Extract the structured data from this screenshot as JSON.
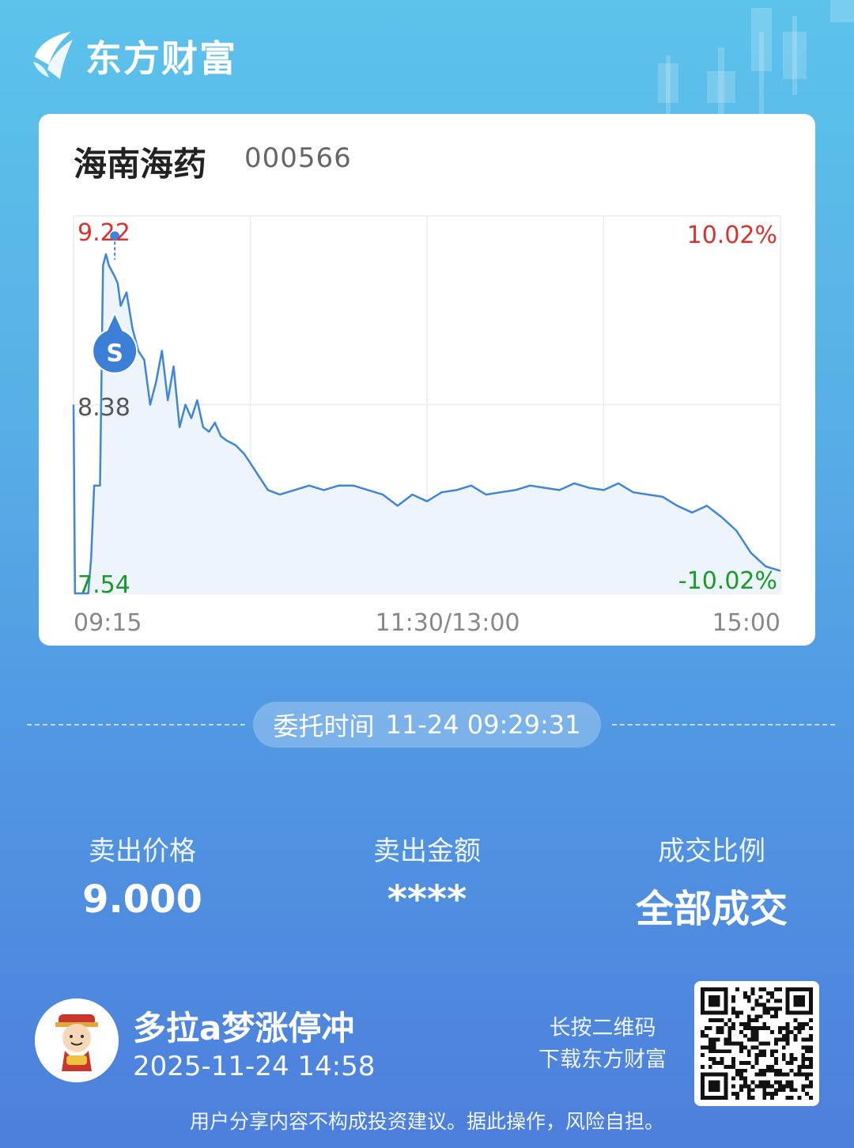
{
  "app": {
    "brand": "东方财富"
  },
  "stock": {
    "name": "海南海药",
    "code": "000566"
  },
  "chart_data": {
    "type": "line",
    "xlabels": [
      "09:15",
      "11:30/13:00",
      "15:00"
    ],
    "ylim": [
      7.54,
      9.22
    ],
    "y_tick_labels": [
      "9.22",
      "8.38",
      "7.54"
    ],
    "pct_labels": {
      "top": "10.02%",
      "bottom": "-10.02%"
    },
    "prev_close": 8.38,
    "marker": {
      "label": "S",
      "time": "09:29",
      "price": 9.0
    },
    "series": [
      {
        "x": [
          0,
          0.5,
          1,
          1.5,
          2,
          3,
          4,
          5,
          6,
          7,
          7.5,
          8,
          9,
          10,
          11,
          12,
          14,
          15,
          16,
          18,
          20,
          22,
          24,
          26,
          28,
          30,
          32,
          34,
          36,
          38,
          40,
          42,
          44,
          46,
          48,
          50,
          52,
          55,
          58,
          62,
          66,
          70,
          75,
          80,
          85,
          90,
          95,
          100,
          105,
          110,
          115,
          120,
          125,
          130,
          135,
          140,
          145,
          150,
          155,
          160,
          165,
          170,
          175,
          180,
          185,
          190,
          195,
          200,
          205,
          210,
          215,
          220,
          225,
          230,
          235,
          240
        ],
        "values": [
          8.38,
          7.54,
          7.54,
          7.54,
          7.54,
          7.54,
          7.54,
          7.54,
          7.7,
          8.02,
          8.02,
          8.02,
          8.02,
          9.0,
          9.05,
          9.0,
          8.95,
          8.92,
          8.82,
          8.88,
          8.72,
          8.62,
          8.58,
          8.38,
          8.48,
          8.62,
          8.4,
          8.55,
          8.28,
          8.38,
          8.32,
          8.4,
          8.28,
          8.26,
          8.3,
          8.24,
          8.22,
          8.2,
          8.16,
          8.08,
          8.0,
          7.98,
          8.0,
          8.02,
          8.0,
          8.02,
          8.02,
          8.0,
          7.98,
          7.93,
          7.98,
          7.95,
          7.99,
          8.0,
          8.02,
          7.98,
          7.99,
          8.0,
          8.02,
          8.01,
          8.0,
          8.03,
          8.01,
          8.0,
          8.03,
          7.99,
          7.98,
          7.97,
          7.93,
          7.9,
          7.93,
          7.88,
          7.82,
          7.72,
          7.66,
          7.64
        ]
      }
    ]
  },
  "order": {
    "label": "委托时间",
    "value": "11-24 09:29:31"
  },
  "stats": [
    {
      "label": "卖出价格",
      "value": "9.000"
    },
    {
      "label": "卖出金额",
      "value": "****"
    },
    {
      "label": "成交比例",
      "value": "全部成交"
    }
  ],
  "user": {
    "name": "多拉a梦涨停冲",
    "time": "2025-11-24 14:58"
  },
  "qr": {
    "line1": "长按二维码",
    "line2": "下载东方财富"
  },
  "disclaimer": "用户分享内容不构成投资建议。据此操作，风险自担。",
  "colors": {
    "up": "#d9312f",
    "down": "#1a9a28",
    "line": "#3f86d8",
    "fill": "#eef4fc",
    "grid": "#ececec"
  }
}
